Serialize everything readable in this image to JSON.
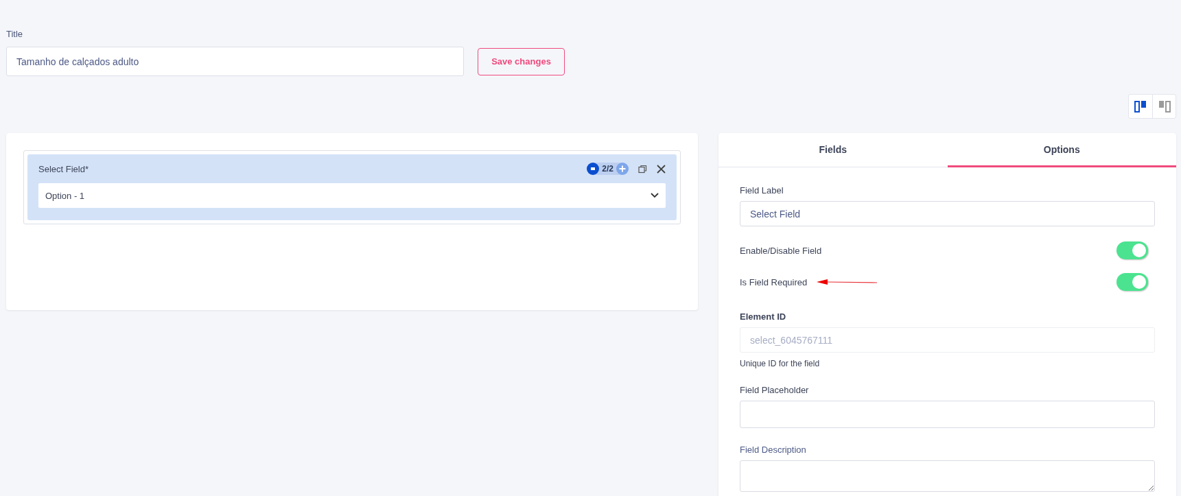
{
  "title_field": {
    "label": "Title",
    "value": "Tamanho de calçados adulto"
  },
  "save_button": "Save changes",
  "view_toggles": [
    {
      "kind": "split",
      "selected": true
    },
    {
      "kind": "sidebar",
      "selected": false
    }
  ],
  "canvas": {
    "field": {
      "label": "Select Field*",
      "counter": "2/2",
      "value": "Option - 1"
    }
  },
  "settings": {
    "tabs": [
      {
        "label": "Fields",
        "selected": false
      },
      {
        "label": "Options",
        "selected": true
      }
    ],
    "field_label": {
      "label": "Field Label",
      "value": "Select Field"
    },
    "toggles": [
      {
        "label": "Enable/Disable Field",
        "on": true,
        "annotated": false
      },
      {
        "label": "Is Field Required",
        "on": true,
        "annotated": true
      }
    ],
    "element_id": {
      "label": "Element ID",
      "value": "select_6045767111",
      "disabled": true,
      "help": "Unique ID for the field"
    },
    "placeholder_field": {
      "label": "Field Placeholder"
    },
    "description_field": {
      "label": "Field Description"
    }
  }
}
